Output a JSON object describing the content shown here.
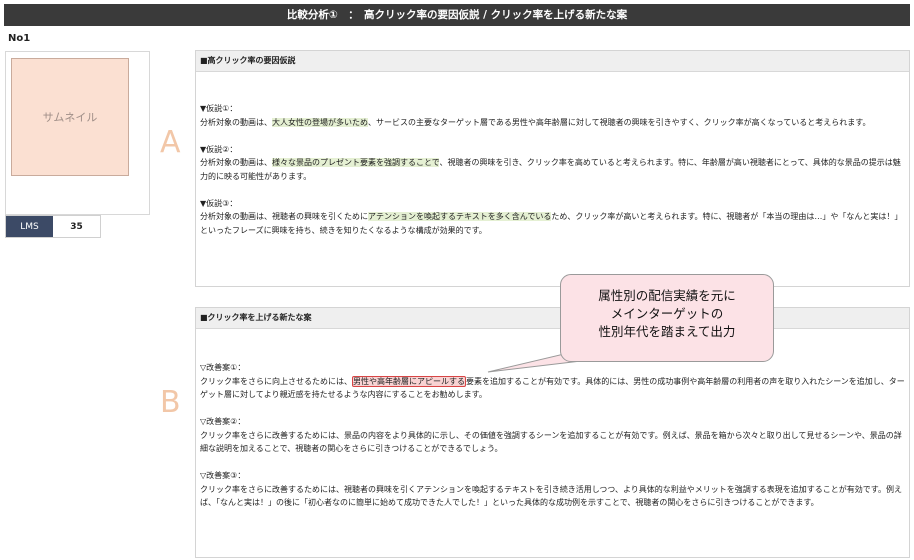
{
  "header": {
    "title": "比較分析①　：　高クリック率の要因仮説 / クリック率を上げる新たな案"
  },
  "item": {
    "label": "No1",
    "thumbnail_text": "サムネイル",
    "metric_name": "LMS",
    "metric_value": "35"
  },
  "letters": {
    "a": "A",
    "b": "B"
  },
  "panel_a": {
    "title": "■高クリック率の要因仮説",
    "hyp1_title": "▼仮説①：",
    "hyp1_pre": "分析対象の動画は、",
    "hyp1_hl": "大人女性の登場が多いため",
    "hyp1_post": "、サービスの主要なターゲット層である男性や高年齢層に対して視聴者の興味を引きやすく、クリック率が高くなっていると考えられます。",
    "hyp2_title": "▼仮説②：",
    "hyp2_pre": "分析対象の動画は、",
    "hyp2_hl": "様々な景品のプレゼント要素を強調することで",
    "hyp2_post": "、視聴者の興味を引き、クリック率を高めていると考えられます。特に、年齢層が高い視聴者にとって、具体的な景品の提示は魅力的に映る可能性があります。",
    "hyp3_title": "▼仮説③：",
    "hyp3_pre": "分析対象の動画は、視聴者の興味を引くために",
    "hyp3_hl": "アテンションを喚起するテキストを多く含んでいる",
    "hyp3_post": "ため、クリック率が高いと考えられます。特に、視聴者が「本当の理由は…」や「なんと実は！」といったフレーズに興味を持ち、続きを知りたくなるような構成が効果的です。"
  },
  "panel_b": {
    "title": "■クリック率を上げる新たな案",
    "p1_title": "▽改善案①：",
    "p1_pre": "クリック率をさらに向上させるためには、",
    "p1_hl": "男性や高年齢層にアピールする",
    "p1_post": "要素を追加することが有効です。具体的には、男性の成功事例や高年齢層の利用者の声を取り入れたシーンを追加し、ターゲット層に対してより親近感を持たせるような内容にすることをお勧めします。",
    "p2_title": "▽改善案②：",
    "p2_body": "クリック率をさらに改善するためには、景品の内容をより具体的に示し、その価値を強調するシーンを追加することが有効です。例えば、景品を箱から次々と取り出して見せるシーンや、景品の詳細な説明を加えることで、視聴者の関心をさらに引きつけることができるでしょう。",
    "p3_title": "▽改善案③：",
    "p3_body": "クリック率をさらに改善するためには、視聴者の興味を引くアテンションを喚起するテキストを引き続き活用しつつ、より具体的な利益やメリットを強調する表現を追加することが有効です。例えば、「なんと実は！」の後に「初心者なのに簡単に始めて成功できた人でした！」といった具体的な成功例を示すことで、視聴者の関心をさらに引きつけることができます。"
  },
  "callout": {
    "text": "属性別の配信実績を元に\nメインターゲットの\n性別年代を踏まえて出力"
  },
  "colors": {
    "header_bg": "#3a3a3a",
    "metric_bg": "#3c4a66",
    "thumbnail_bg": "#fbe0d2",
    "highlight_green": "#e5f0d3",
    "highlight_red": "#f8d3d3",
    "callout_bg": "#fce2e6",
    "letter_color": "#f2c7a8"
  }
}
